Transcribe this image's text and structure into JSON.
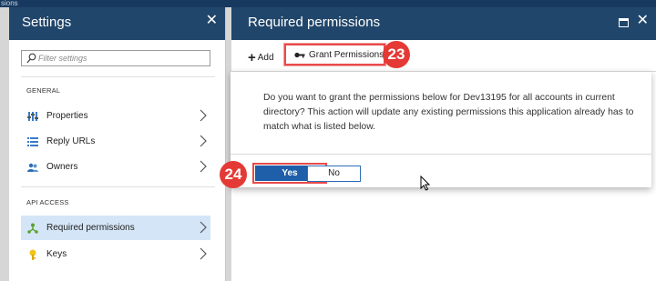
{
  "top_strip": {
    "text": "sions"
  },
  "settings_blade": {
    "title": "Settings",
    "close": "✕",
    "filter_placeholder": "Filter settings",
    "sections": {
      "general": "GENERAL",
      "api_access": "API ACCESS"
    },
    "items": [
      {
        "label": "Properties",
        "icon": "properties-icon"
      },
      {
        "label": "Reply URLs",
        "icon": "list-icon"
      },
      {
        "label": "Owners",
        "icon": "users-icon"
      },
      {
        "label": "Required permissions",
        "icon": "permissions-icon",
        "active": true
      },
      {
        "label": "Keys",
        "icon": "key-icon"
      }
    ]
  },
  "permissions_blade": {
    "title": "Required permissions",
    "close": "✕",
    "add_label": "Add",
    "grant_label": "Grant Permissions"
  },
  "annotations": {
    "grant_badge": "23",
    "yes_badge": "24",
    "color": "#e53935"
  },
  "dialog": {
    "message": "Do you want to grant the permissions below for Dev13195 for all accounts in current directory? This action will update any existing permissions this application already has to match what is listed below.",
    "yes_label": "Yes",
    "no_label": "No"
  },
  "colors": {
    "header": "#21466b",
    "accent": "#1f5ea8",
    "selection": "#d4e5f7"
  }
}
